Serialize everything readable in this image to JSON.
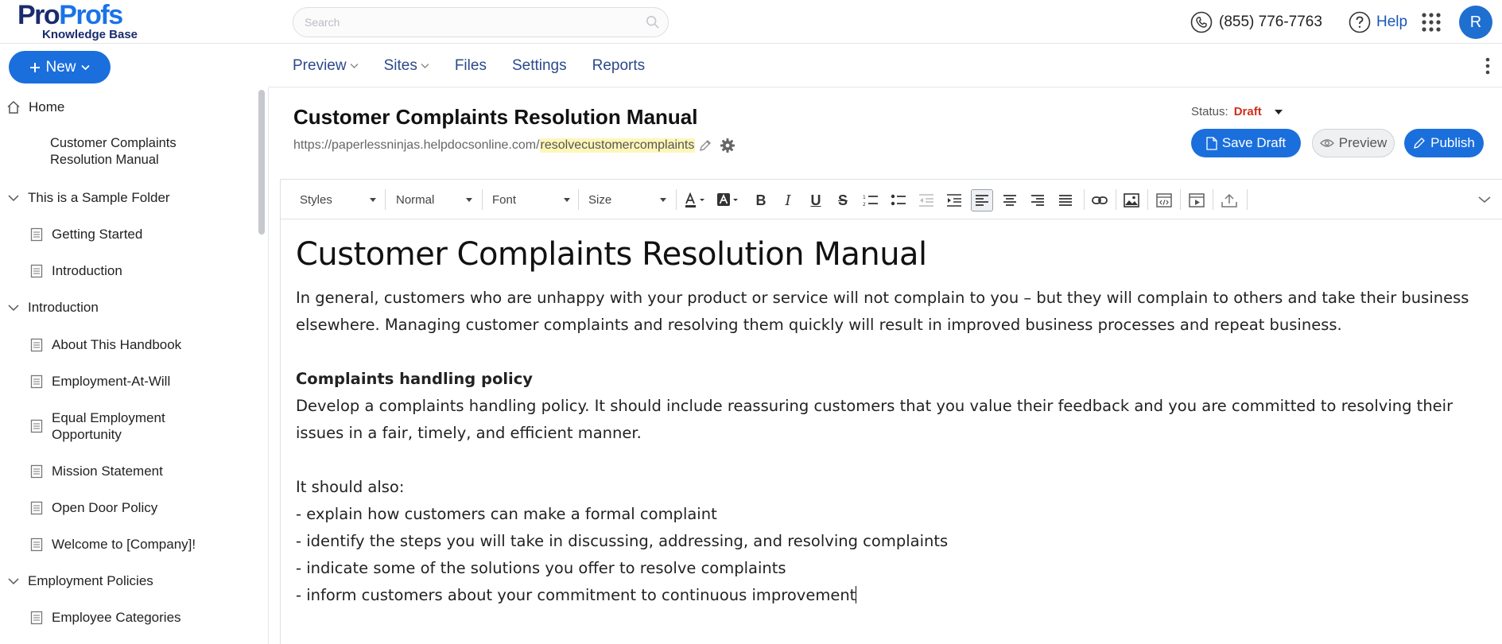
{
  "brand": {
    "logo_part1": "Pro",
    "logo_part2": "Profs",
    "product": "Knowledge Base",
    "colors": {
      "primary": "#1a6fdc",
      "navy": "#1a2b6d",
      "draft": "#d0301b"
    }
  },
  "header": {
    "search_placeholder": "Search",
    "phone": "(855) 776-7763",
    "help": "Help",
    "avatar_initial": "R"
  },
  "new_button": "New",
  "nav": {
    "items": [
      {
        "label": "Preview",
        "dropdown": true
      },
      {
        "label": "Sites",
        "dropdown": true
      },
      {
        "label": "Files",
        "dropdown": false
      },
      {
        "label": "Settings",
        "dropdown": false
      },
      {
        "label": "Reports",
        "dropdown": false
      }
    ]
  },
  "sidebar": {
    "home": "Home",
    "current_page_line1": "Customer Complaints",
    "current_page_line2": "Resolution Manual",
    "folder1": "This is a Sample Folder",
    "folder1_items": [
      "Getting Started",
      "Introduction"
    ],
    "folder2": "Introduction",
    "folder2_items": [
      "About This Handbook",
      "Employment-At-Will",
      "Equal Employment",
      "Opportunity",
      "Mission Statement",
      "Open Door Policy",
      "Welcome to [Company]!"
    ],
    "folder3": "Employment Policies",
    "folder3_items": [
      "Employee Categories"
    ]
  },
  "document": {
    "title": "Customer Complaints Resolution Manual",
    "url_base": "https://paperlessninjas.helpdocsonline.com/",
    "url_slug": "resolvecustomercomplaints",
    "status_label": "Status:",
    "status_value": "Draft",
    "save_draft": "Save Draft",
    "preview": "Preview",
    "publish": "Publish"
  },
  "toolbar": {
    "styles": "Styles",
    "format": "Normal",
    "font": "Font",
    "size": "Size",
    "bold": "B",
    "italic": "I",
    "underline": "U",
    "strike": "S"
  },
  "content": {
    "heading": "Customer Complaints Resolution Manual",
    "para1_line1": "In general, customers who are unhappy with your product or service will not complain to you – but they will complain to others and take their business",
    "para1_line2": "elsewhere. Managing customer complaints and resolving them quickly will result in improved business processes and repeat business.",
    "subheading": "Complaints handling policy",
    "para2_line1": "Develop a complaints handling policy. It should include reassuring customers that you value their feedback and you are committed to resolving their",
    "para2_line2": "issues in a fair, timely, and efficient manner.",
    "also": "It should also:",
    "list": [
      "- explain how customers can make a formal complaint",
      "- identify the steps you will take in discussing, addressing, and resolving complaints",
      "- indicate some of the solutions you offer to resolve complaints",
      "- inform customers about your commitment to continuous improvement"
    ]
  }
}
